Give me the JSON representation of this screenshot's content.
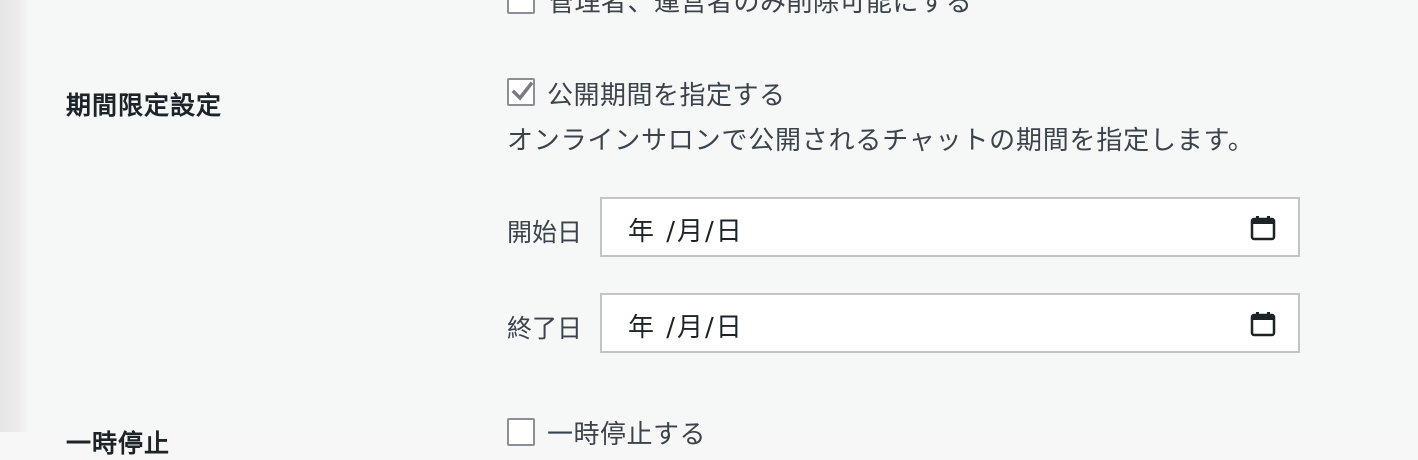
{
  "top_option": {
    "label": "管理者、運営者のみ削除可能にする",
    "checked": false
  },
  "period_section": {
    "title": "期間限定設定",
    "checkbox": {
      "label": "公開期間を指定する",
      "checked": true
    },
    "description": "オンラインサロンで公開されるチャットの期間を指定します。",
    "start_date": {
      "label": "開始日",
      "value": "年 /月/日",
      "icon": "calendar-icon"
    },
    "end_date": {
      "label": "終了日",
      "value": "年 /月/日",
      "icon": "calendar-icon"
    }
  },
  "pause_section": {
    "title": "一時停止",
    "checkbox": {
      "label": "一時停止する",
      "checked": false
    }
  },
  "colors": {
    "checkmark": "#787c82",
    "input_border": "#c3c4c7",
    "text": "#3c434a"
  }
}
